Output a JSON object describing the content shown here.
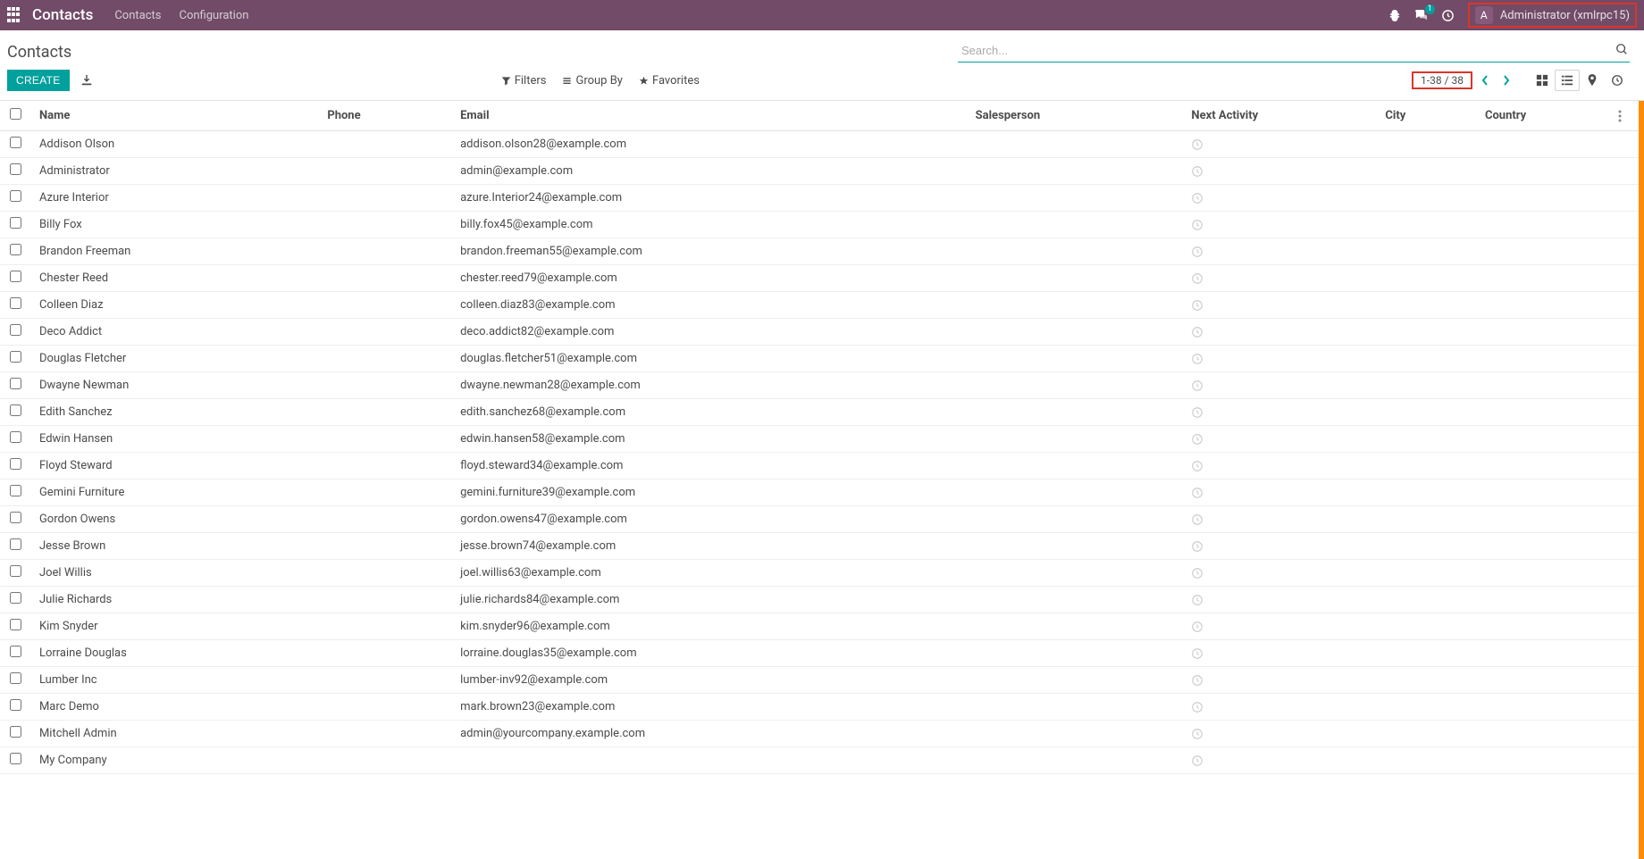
{
  "navbar": {
    "brand": "Contacts",
    "links": [
      "Contacts",
      "Configuration"
    ],
    "notif_badge": "1",
    "avatar_initial": "A",
    "user_name": "Administrator (xmlrpc15)"
  },
  "control": {
    "breadcrumb": "Contacts",
    "search_placeholder": "Search...",
    "create": "CREATE",
    "filters": "Filters",
    "groupby": "Group By",
    "favorites": "Favorites",
    "pager": "1-38 / 38"
  },
  "columns": {
    "name": "Name",
    "phone": "Phone",
    "email": "Email",
    "salesperson": "Salesperson",
    "next_activity": "Next Activity",
    "city": "City",
    "country": "Country"
  },
  "rows": [
    {
      "name": "Addison Olson",
      "phone": "",
      "email": "addison.olson28@example.com",
      "salesperson": "",
      "city": "",
      "country": ""
    },
    {
      "name": "Administrator",
      "phone": "",
      "email": "admin@example.com",
      "salesperson": "",
      "city": "",
      "country": ""
    },
    {
      "name": "Azure Interior",
      "phone": "",
      "email": "azure.Interior24@example.com",
      "salesperson": "",
      "city": "",
      "country": ""
    },
    {
      "name": "Billy Fox",
      "phone": "",
      "email": "billy.fox45@example.com",
      "salesperson": "",
      "city": "",
      "country": ""
    },
    {
      "name": "Brandon Freeman",
      "phone": "",
      "email": "brandon.freeman55@example.com",
      "salesperson": "",
      "city": "",
      "country": ""
    },
    {
      "name": "Chester Reed",
      "phone": "",
      "email": "chester.reed79@example.com",
      "salesperson": "",
      "city": "",
      "country": ""
    },
    {
      "name": "Colleen Diaz",
      "phone": "",
      "email": "colleen.diaz83@example.com",
      "salesperson": "",
      "city": "",
      "country": ""
    },
    {
      "name": "Deco Addict",
      "phone": "",
      "email": "deco.addict82@example.com",
      "salesperson": "",
      "city": "",
      "country": ""
    },
    {
      "name": "Douglas Fletcher",
      "phone": "",
      "email": "douglas.fletcher51@example.com",
      "salesperson": "",
      "city": "",
      "country": ""
    },
    {
      "name": "Dwayne Newman",
      "phone": "",
      "email": "dwayne.newman28@example.com",
      "salesperson": "",
      "city": "",
      "country": ""
    },
    {
      "name": "Edith Sanchez",
      "phone": "",
      "email": "edith.sanchez68@example.com",
      "salesperson": "",
      "city": "",
      "country": ""
    },
    {
      "name": "Edwin Hansen",
      "phone": "",
      "email": "edwin.hansen58@example.com",
      "salesperson": "",
      "city": "",
      "country": ""
    },
    {
      "name": "Floyd Steward",
      "phone": "",
      "email": "floyd.steward34@example.com",
      "salesperson": "",
      "city": "",
      "country": ""
    },
    {
      "name": "Gemini Furniture",
      "phone": "",
      "email": "gemini.furniture39@example.com",
      "salesperson": "",
      "city": "",
      "country": ""
    },
    {
      "name": "Gordon Owens",
      "phone": "",
      "email": "gordon.owens47@example.com",
      "salesperson": "",
      "city": "",
      "country": ""
    },
    {
      "name": "Jesse Brown",
      "phone": "",
      "email": "jesse.brown74@example.com",
      "salesperson": "",
      "city": "",
      "country": ""
    },
    {
      "name": "Joel Willis",
      "phone": "",
      "email": "joel.willis63@example.com",
      "salesperson": "",
      "city": "",
      "country": ""
    },
    {
      "name": "Julie Richards",
      "phone": "",
      "email": "julie.richards84@example.com",
      "salesperson": "",
      "city": "",
      "country": ""
    },
    {
      "name": "Kim Snyder",
      "phone": "",
      "email": "kim.snyder96@example.com",
      "salesperson": "",
      "city": "",
      "country": ""
    },
    {
      "name": "Lorraine Douglas",
      "phone": "",
      "email": "lorraine.douglas35@example.com",
      "salesperson": "",
      "city": "",
      "country": ""
    },
    {
      "name": "Lumber Inc",
      "phone": "",
      "email": "lumber-inv92@example.com",
      "salesperson": "",
      "city": "",
      "country": ""
    },
    {
      "name": "Marc Demo",
      "phone": "",
      "email": "mark.brown23@example.com",
      "salesperson": "",
      "city": "",
      "country": ""
    },
    {
      "name": "Mitchell Admin",
      "phone": "",
      "email": "admin@yourcompany.example.com",
      "salesperson": "",
      "city": "",
      "country": ""
    },
    {
      "name": "My Company",
      "phone": "",
      "email": "",
      "salesperson": "",
      "city": "",
      "country": ""
    }
  ]
}
